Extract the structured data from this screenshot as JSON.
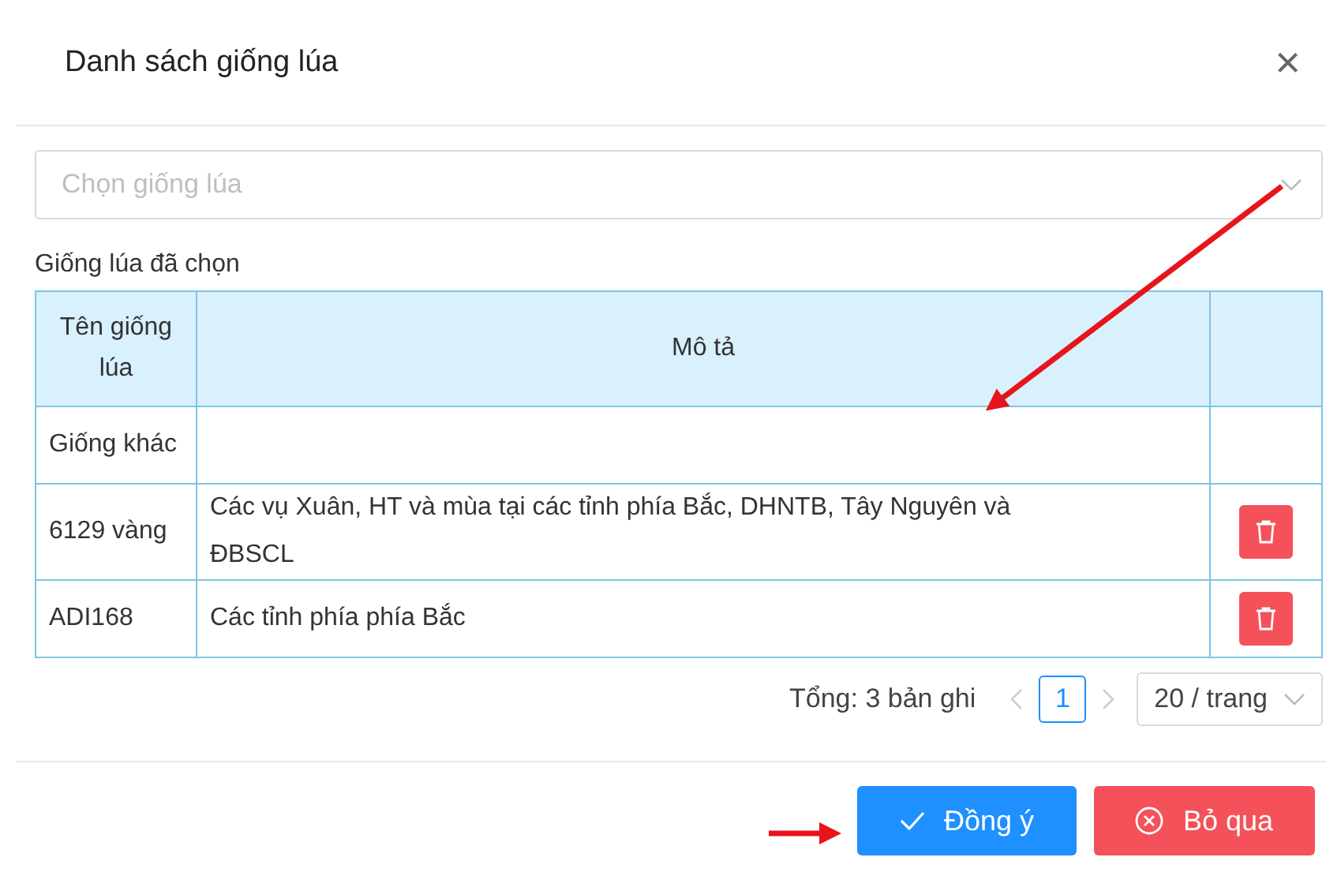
{
  "dialog": {
    "title": "Danh sách giống lúa",
    "close_icon": "×"
  },
  "select": {
    "placeholder": "Chọn giống lúa"
  },
  "selected_label": "Giống lúa đã chọn",
  "table": {
    "columns": [
      "Tên giống lúa",
      "Mô tả"
    ],
    "rows": [
      {
        "name": "Giống khác",
        "deletable": false
      },
      {
        "name": "6129 vàng",
        "description": "Các vụ Xuân, HT và mùa tại các tỉnh phía Bắc, DHNTB, Tây Nguyên và ĐBSCL",
        "deletable": true
      },
      {
        "name": "ADI168",
        "description": "Các tỉnh phía phía Bắc",
        "deletable": true
      }
    ]
  },
  "pagination": {
    "total": "Tổng: 3 bản ghi",
    "pages": [
      {
        "label": "1",
        "selected": true
      }
    ],
    "page_size": "20 / trang"
  },
  "buttons": [
    {
      "label": "Đồng ý",
      "kind": "primary"
    },
    {
      "label": "Bỏ qua",
      "kind": "danger"
    }
  ]
}
